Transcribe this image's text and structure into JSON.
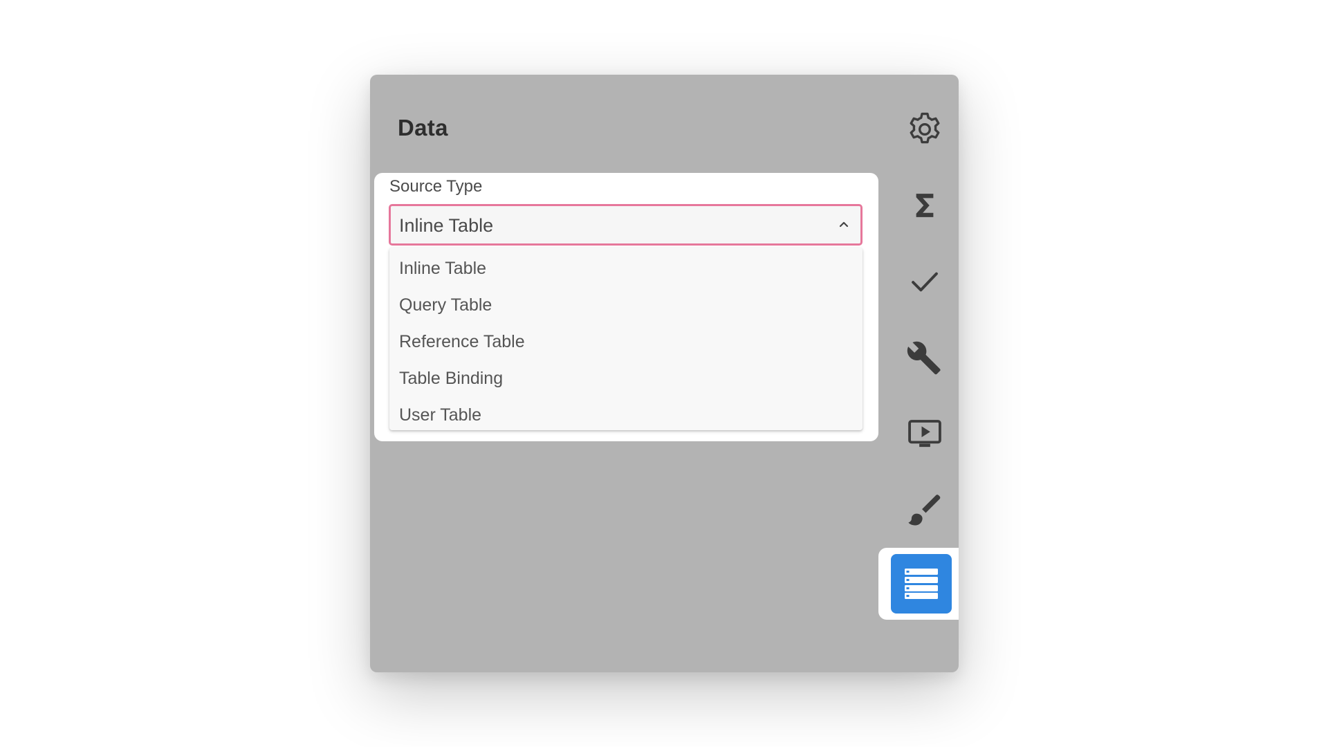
{
  "panel": {
    "title": "Data"
  },
  "source_type": {
    "label": "Source Type",
    "selected": "Inline Table",
    "options": [
      "Inline Table",
      "Query Table",
      "Reference Table",
      "Table Binding",
      "User Table"
    ]
  },
  "rail": {
    "icons": [
      "gear-icon",
      "sigma-icon",
      "check-icon",
      "wrench-icon",
      "play-screen-icon",
      "brush-icon",
      "table-rows-icon"
    ],
    "active": "table-rows-icon"
  },
  "colors": {
    "panel_bg": "#b3b3b3",
    "focus_border": "#e6779b",
    "active_accent": "#2f86e0",
    "icon": "#3c3c3c"
  }
}
